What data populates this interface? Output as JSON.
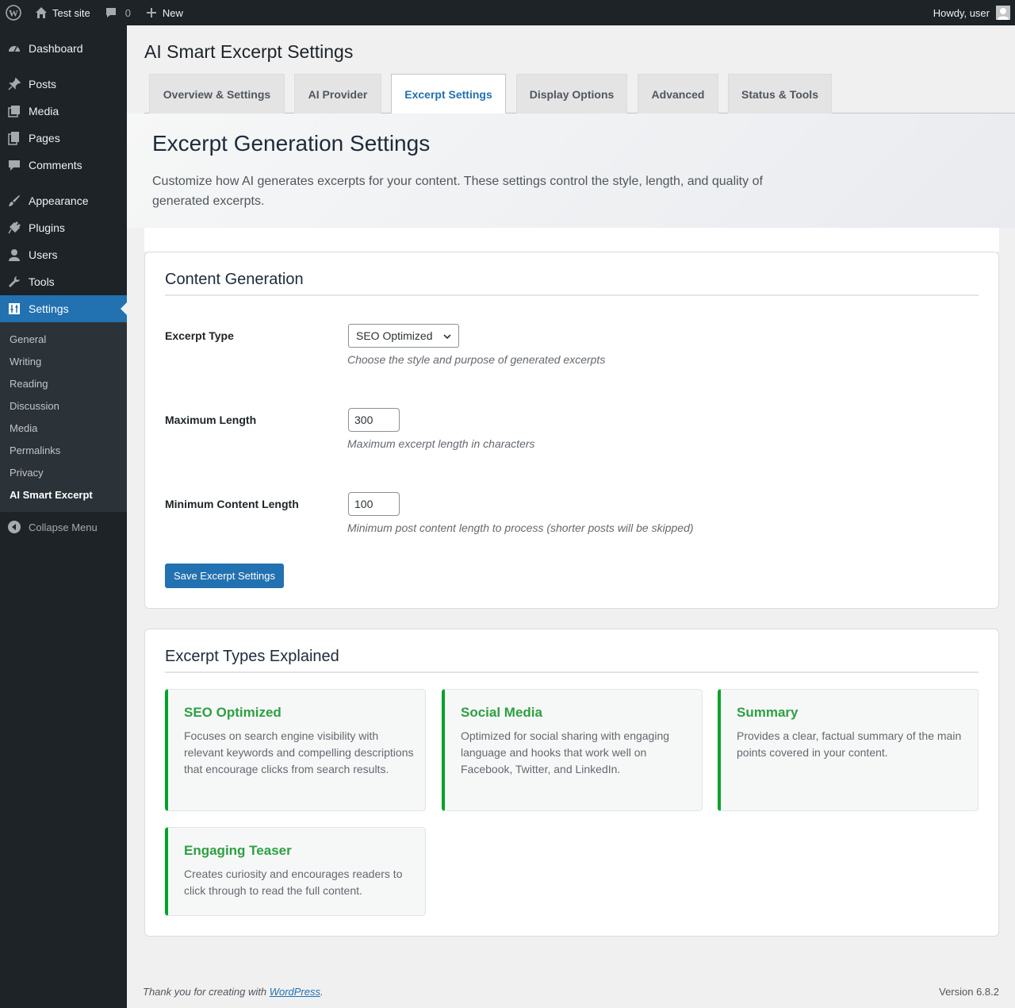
{
  "admin_bar": {
    "site_name": "Test site",
    "comments_count": "0",
    "new_label": "New",
    "greeting": "Howdy, user"
  },
  "sidebar": {
    "items": [
      {
        "label": "Dashboard",
        "icon": "dashboard-icon"
      },
      {
        "label": "Posts",
        "icon": "pin-icon"
      },
      {
        "label": "Media",
        "icon": "media-icon"
      },
      {
        "label": "Pages",
        "icon": "pages-icon"
      },
      {
        "label": "Comments",
        "icon": "comment-icon"
      },
      {
        "label": "Appearance",
        "icon": "brush-icon"
      },
      {
        "label": "Plugins",
        "icon": "plugin-icon"
      },
      {
        "label": "Users",
        "icon": "user-icon"
      },
      {
        "label": "Tools",
        "icon": "wrench-icon"
      },
      {
        "label": "Settings",
        "icon": "sliders-icon"
      }
    ],
    "submenu": [
      "General",
      "Writing",
      "Reading",
      "Discussion",
      "Media",
      "Permalinks",
      "Privacy",
      "AI Smart Excerpt"
    ],
    "collapse_label": "Collapse Menu"
  },
  "page": {
    "title": "AI Smart Excerpt Settings",
    "tabs": [
      "Overview & Settings",
      "AI Provider",
      "Excerpt Settings",
      "Display Options",
      "Advanced",
      "Status & Tools"
    ],
    "active_tab": "Excerpt Settings"
  },
  "hero": {
    "title": "Excerpt Generation Settings",
    "description": "Customize how AI generates excerpts for your content. These settings control the style, length, and quality of generated excerpts."
  },
  "content_generation": {
    "heading": "Content Generation",
    "excerpt_type": {
      "label": "Excerpt Type",
      "value": "SEO Optimized",
      "description": "Choose the style and purpose of generated excerpts"
    },
    "max_length": {
      "label": "Maximum Length",
      "value": "300",
      "description": "Maximum excerpt length in characters"
    },
    "min_content_length": {
      "label": "Minimum Content Length",
      "value": "100",
      "description": "Minimum post content length to process (shorter posts will be skipped)"
    },
    "save_label": "Save Excerpt Settings"
  },
  "types_explained": {
    "heading": "Excerpt Types Explained",
    "types": [
      {
        "title": "SEO Optimized",
        "text": "Focuses on search engine visibility with relevant keywords and compelling descriptions that encourage clicks from search results."
      },
      {
        "title": "Social Media",
        "text": "Optimized for social sharing with engaging language and hooks that work well on Facebook, Twitter, and LinkedIn."
      },
      {
        "title": "Summary",
        "text": "Provides a clear, factual summary of the main points covered in your content."
      },
      {
        "title": "Engaging Teaser",
        "text": "Creates curiosity and encourages readers to click through to read the full content."
      }
    ],
    "accent_color": "#00a32a"
  },
  "footer": {
    "thanks_prefix": "Thank you for creating with ",
    "thanks_link": "WordPress",
    "thanks_suffix": ".",
    "version": "Version 6.8.2"
  }
}
